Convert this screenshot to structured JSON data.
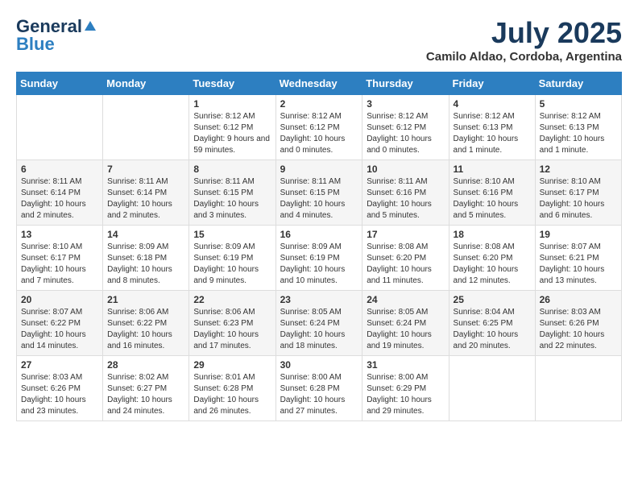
{
  "header": {
    "logo_general": "General",
    "logo_blue": "Blue",
    "month_year": "July 2025",
    "location": "Camilo Aldao, Cordoba, Argentina"
  },
  "days_of_week": [
    "Sunday",
    "Monday",
    "Tuesday",
    "Wednesday",
    "Thursday",
    "Friday",
    "Saturday"
  ],
  "weeks": [
    [
      {
        "day": "",
        "info": ""
      },
      {
        "day": "",
        "info": ""
      },
      {
        "day": "1",
        "info": "Sunrise: 8:12 AM\nSunset: 6:12 PM\nDaylight: 9 hours and 59 minutes."
      },
      {
        "day": "2",
        "info": "Sunrise: 8:12 AM\nSunset: 6:12 PM\nDaylight: 10 hours and 0 minutes."
      },
      {
        "day": "3",
        "info": "Sunrise: 8:12 AM\nSunset: 6:12 PM\nDaylight: 10 hours and 0 minutes."
      },
      {
        "day": "4",
        "info": "Sunrise: 8:12 AM\nSunset: 6:13 PM\nDaylight: 10 hours and 1 minute."
      },
      {
        "day": "5",
        "info": "Sunrise: 8:12 AM\nSunset: 6:13 PM\nDaylight: 10 hours and 1 minute."
      }
    ],
    [
      {
        "day": "6",
        "info": "Sunrise: 8:11 AM\nSunset: 6:14 PM\nDaylight: 10 hours and 2 minutes."
      },
      {
        "day": "7",
        "info": "Sunrise: 8:11 AM\nSunset: 6:14 PM\nDaylight: 10 hours and 2 minutes."
      },
      {
        "day": "8",
        "info": "Sunrise: 8:11 AM\nSunset: 6:15 PM\nDaylight: 10 hours and 3 minutes."
      },
      {
        "day": "9",
        "info": "Sunrise: 8:11 AM\nSunset: 6:15 PM\nDaylight: 10 hours and 4 minutes."
      },
      {
        "day": "10",
        "info": "Sunrise: 8:11 AM\nSunset: 6:16 PM\nDaylight: 10 hours and 5 minutes."
      },
      {
        "day": "11",
        "info": "Sunrise: 8:10 AM\nSunset: 6:16 PM\nDaylight: 10 hours and 5 minutes."
      },
      {
        "day": "12",
        "info": "Sunrise: 8:10 AM\nSunset: 6:17 PM\nDaylight: 10 hours and 6 minutes."
      }
    ],
    [
      {
        "day": "13",
        "info": "Sunrise: 8:10 AM\nSunset: 6:17 PM\nDaylight: 10 hours and 7 minutes."
      },
      {
        "day": "14",
        "info": "Sunrise: 8:09 AM\nSunset: 6:18 PM\nDaylight: 10 hours and 8 minutes."
      },
      {
        "day": "15",
        "info": "Sunrise: 8:09 AM\nSunset: 6:19 PM\nDaylight: 10 hours and 9 minutes."
      },
      {
        "day": "16",
        "info": "Sunrise: 8:09 AM\nSunset: 6:19 PM\nDaylight: 10 hours and 10 minutes."
      },
      {
        "day": "17",
        "info": "Sunrise: 8:08 AM\nSunset: 6:20 PM\nDaylight: 10 hours and 11 minutes."
      },
      {
        "day": "18",
        "info": "Sunrise: 8:08 AM\nSunset: 6:20 PM\nDaylight: 10 hours and 12 minutes."
      },
      {
        "day": "19",
        "info": "Sunrise: 8:07 AM\nSunset: 6:21 PM\nDaylight: 10 hours and 13 minutes."
      }
    ],
    [
      {
        "day": "20",
        "info": "Sunrise: 8:07 AM\nSunset: 6:22 PM\nDaylight: 10 hours and 14 minutes."
      },
      {
        "day": "21",
        "info": "Sunrise: 8:06 AM\nSunset: 6:22 PM\nDaylight: 10 hours and 16 minutes."
      },
      {
        "day": "22",
        "info": "Sunrise: 8:06 AM\nSunset: 6:23 PM\nDaylight: 10 hours and 17 minutes."
      },
      {
        "day": "23",
        "info": "Sunrise: 8:05 AM\nSunset: 6:24 PM\nDaylight: 10 hours and 18 minutes."
      },
      {
        "day": "24",
        "info": "Sunrise: 8:05 AM\nSunset: 6:24 PM\nDaylight: 10 hours and 19 minutes."
      },
      {
        "day": "25",
        "info": "Sunrise: 8:04 AM\nSunset: 6:25 PM\nDaylight: 10 hours and 20 minutes."
      },
      {
        "day": "26",
        "info": "Sunrise: 8:03 AM\nSunset: 6:26 PM\nDaylight: 10 hours and 22 minutes."
      }
    ],
    [
      {
        "day": "27",
        "info": "Sunrise: 8:03 AM\nSunset: 6:26 PM\nDaylight: 10 hours and 23 minutes."
      },
      {
        "day": "28",
        "info": "Sunrise: 8:02 AM\nSunset: 6:27 PM\nDaylight: 10 hours and 24 minutes."
      },
      {
        "day": "29",
        "info": "Sunrise: 8:01 AM\nSunset: 6:28 PM\nDaylight: 10 hours and 26 minutes."
      },
      {
        "day": "30",
        "info": "Sunrise: 8:00 AM\nSunset: 6:28 PM\nDaylight: 10 hours and 27 minutes."
      },
      {
        "day": "31",
        "info": "Sunrise: 8:00 AM\nSunset: 6:29 PM\nDaylight: 10 hours and 29 minutes."
      },
      {
        "day": "",
        "info": ""
      },
      {
        "day": "",
        "info": ""
      }
    ]
  ]
}
